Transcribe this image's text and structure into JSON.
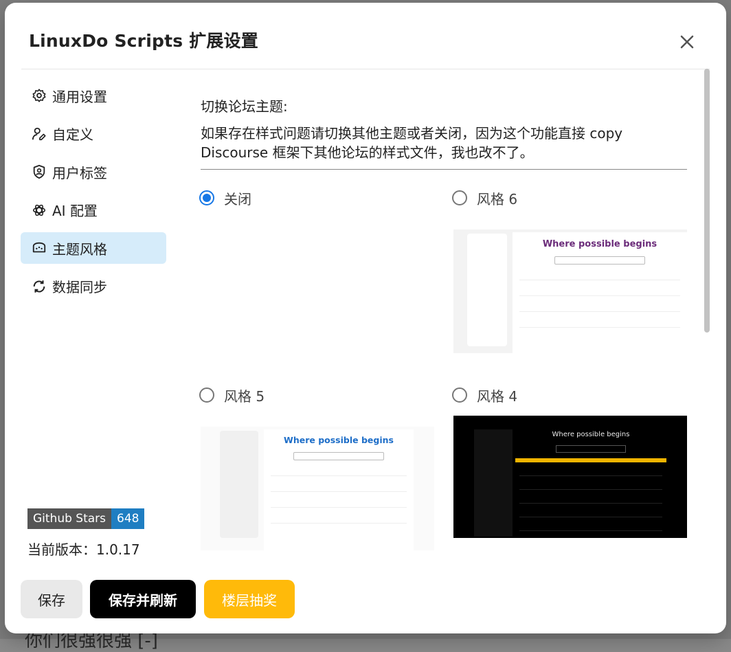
{
  "modal": {
    "title": "LinuxDo Scripts 扩展设置",
    "close_icon": "close-icon"
  },
  "sidebar": {
    "items": [
      {
        "label": "通用设置",
        "icon": "gear-icon",
        "active": false
      },
      {
        "label": "自定义",
        "icon": "user-edit-icon",
        "active": false
      },
      {
        "label": "用户标签",
        "icon": "user-badge-icon",
        "active": false
      },
      {
        "label": "AI 配置",
        "icon": "openai-icon",
        "active": false
      },
      {
        "label": "主题风格",
        "icon": "theme-icon",
        "active": true
      },
      {
        "label": "数据同步",
        "icon": "sync-icon",
        "active": false
      }
    ],
    "stars_label": "Github Stars",
    "stars_count": "648",
    "version_label": "当前版本：",
    "version_value": "1.0.17"
  },
  "content": {
    "title": "切换论坛主题:",
    "description": "如果存在样式问题请切换其他主题或者关闭，因为这个功能直接 copy Discourse 框架下其他论坛的样式文件，我也改不了。",
    "options": [
      {
        "label": "关闭",
        "checked": true
      },
      {
        "label": "风格 6",
        "checked": false,
        "preview_heading": "Where possible begins"
      },
      {
        "label": "风格 5",
        "checked": false,
        "preview_heading": "Where possible begins"
      },
      {
        "label": "风格 4",
        "checked": false,
        "preview_heading": "Where possible begins"
      }
    ]
  },
  "footer": {
    "save_label": "保存",
    "save_refresh_label": "保存并刷新",
    "lottery_label": "楼层抽奖"
  },
  "background": {
    "peek_text": "你们很强很强 [-]"
  },
  "colors": {
    "accent": "#1677e6",
    "active_nav_bg": "#d6ecfa",
    "lottery": "#ffba0a",
    "stars_badge": "#1f7ec2"
  }
}
